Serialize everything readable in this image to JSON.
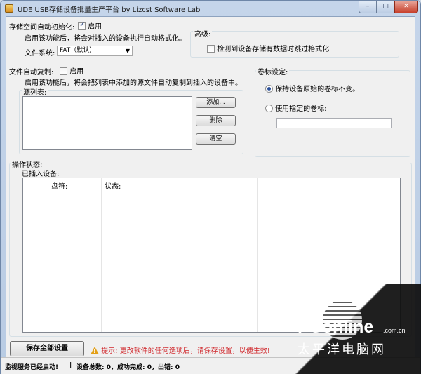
{
  "window": {
    "title": "UDE USB存储设备批量生产平台    by Lizcst Software Lab",
    "minimize": "–",
    "maximize": "□",
    "close": "✕"
  },
  "storage_init": {
    "label": "存储空间自动初始化:",
    "enable_label": "启用",
    "enable_checked": true,
    "description": "启用该功能后，将会对插入的设备执行自动格式化。",
    "filesystem_label": "文件系统:",
    "filesystem_value": "FAT（默认）"
  },
  "advanced": {
    "label": "高级:",
    "skip_format_label": "检测到设备存储有数据时跳过格式化",
    "skip_format_checked": false
  },
  "file_copy": {
    "label": "文件自动复制:",
    "enable_label": "启用",
    "enable_checked": false,
    "description": "启用该功能后，将会把列表中添加的源文件自动复制到插入的设备中。",
    "source_list_label": "源列表:",
    "add_button": "添加...",
    "delete_button": "删除",
    "clear_button": "清空"
  },
  "volume_label": {
    "label": "卷标设定:",
    "keep_option": "保持设备原始的卷标不变。",
    "use_option": "使用指定的卷标:",
    "selected": "keep",
    "custom_value": ""
  },
  "operation": {
    "label": "操作状态:",
    "devices_label": "已插入设备:",
    "columns": [
      "",
      "盘符:",
      "状态:",
      ""
    ]
  },
  "footer": {
    "save_button": "保存全部设置",
    "hint": "提示: 更改软件的任何选项后，请保存设置，以便生效!",
    "hint_color": "#d0282c"
  },
  "status": {
    "service": "监视服务已经启动!",
    "separator": "|",
    "counts": "设备总数: 0，成功完成: 0，出错: 0"
  },
  "watermark": {
    "brand": "PConline",
    "domain": ".com.cn",
    "cn": "太平洋电脑网"
  }
}
